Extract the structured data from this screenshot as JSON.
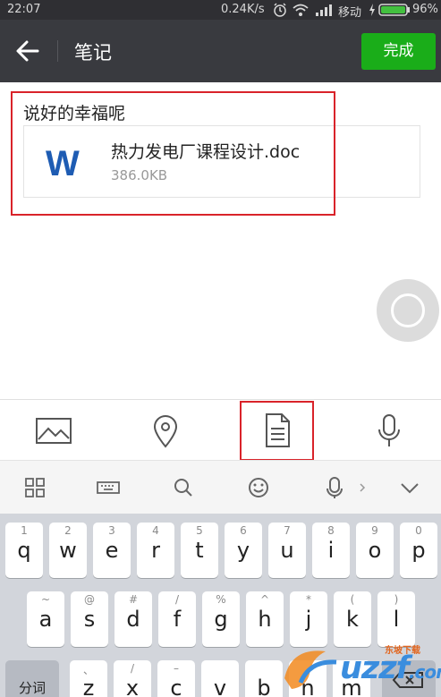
{
  "status_bar": {
    "time": "22:07",
    "speed": "0.24K/s",
    "carrier": "移动",
    "battery": "96%"
  },
  "header": {
    "title": "笔记",
    "done_label": "完成"
  },
  "note": {
    "title": "说好的幸福呢",
    "attachment": {
      "icon_letter": "W",
      "name": "热力发电厂课程设计.doc",
      "size": "386.0KB"
    }
  },
  "keyboard": {
    "rows": [
      [
        {
          "hint": "1",
          "key": "q"
        },
        {
          "hint": "2",
          "key": "w"
        },
        {
          "hint": "3",
          "key": "e"
        },
        {
          "hint": "4",
          "key": "r"
        },
        {
          "hint": "5",
          "key": "t"
        },
        {
          "hint": "6",
          "key": "y"
        },
        {
          "hint": "7",
          "key": "u"
        },
        {
          "hint": "8",
          "key": "i"
        },
        {
          "hint": "9",
          "key": "o"
        },
        {
          "hint": "0",
          "key": "p"
        }
      ],
      [
        {
          "hint": "~",
          "key": "a"
        },
        {
          "hint": "@",
          "key": "s"
        },
        {
          "hint": "#",
          "key": "d"
        },
        {
          "hint": "/",
          "key": "f"
        },
        {
          "hint": "%",
          "key": "g"
        },
        {
          "hint": "^",
          "key": "h"
        },
        {
          "hint": "*",
          "key": "j"
        },
        {
          "hint": "(",
          "key": "k"
        },
        {
          "hint": ")",
          "key": "l"
        }
      ],
      [
        {
          "hint": "、",
          "key": "z"
        },
        {
          "hint": "/",
          "key": "x"
        },
        {
          "hint": "–",
          "key": "c"
        },
        {
          "hint": "",
          "key": "v"
        },
        {
          "hint": "",
          "key": "b"
        },
        {
          "hint": "",
          "key": "n"
        },
        {
          "hint": "",
          "key": "m"
        }
      ]
    ],
    "segment_label": "分词"
  },
  "watermark": {
    "brand": "uzzf",
    "tld": ".com",
    "tagline": "东坡下载"
  },
  "colors": {
    "title_bar": "#393a3f",
    "status_bar": "#2f2f33",
    "done_button": "#1aad19",
    "highlight": "#d9232a",
    "word_blue": "#1e5cb3"
  }
}
